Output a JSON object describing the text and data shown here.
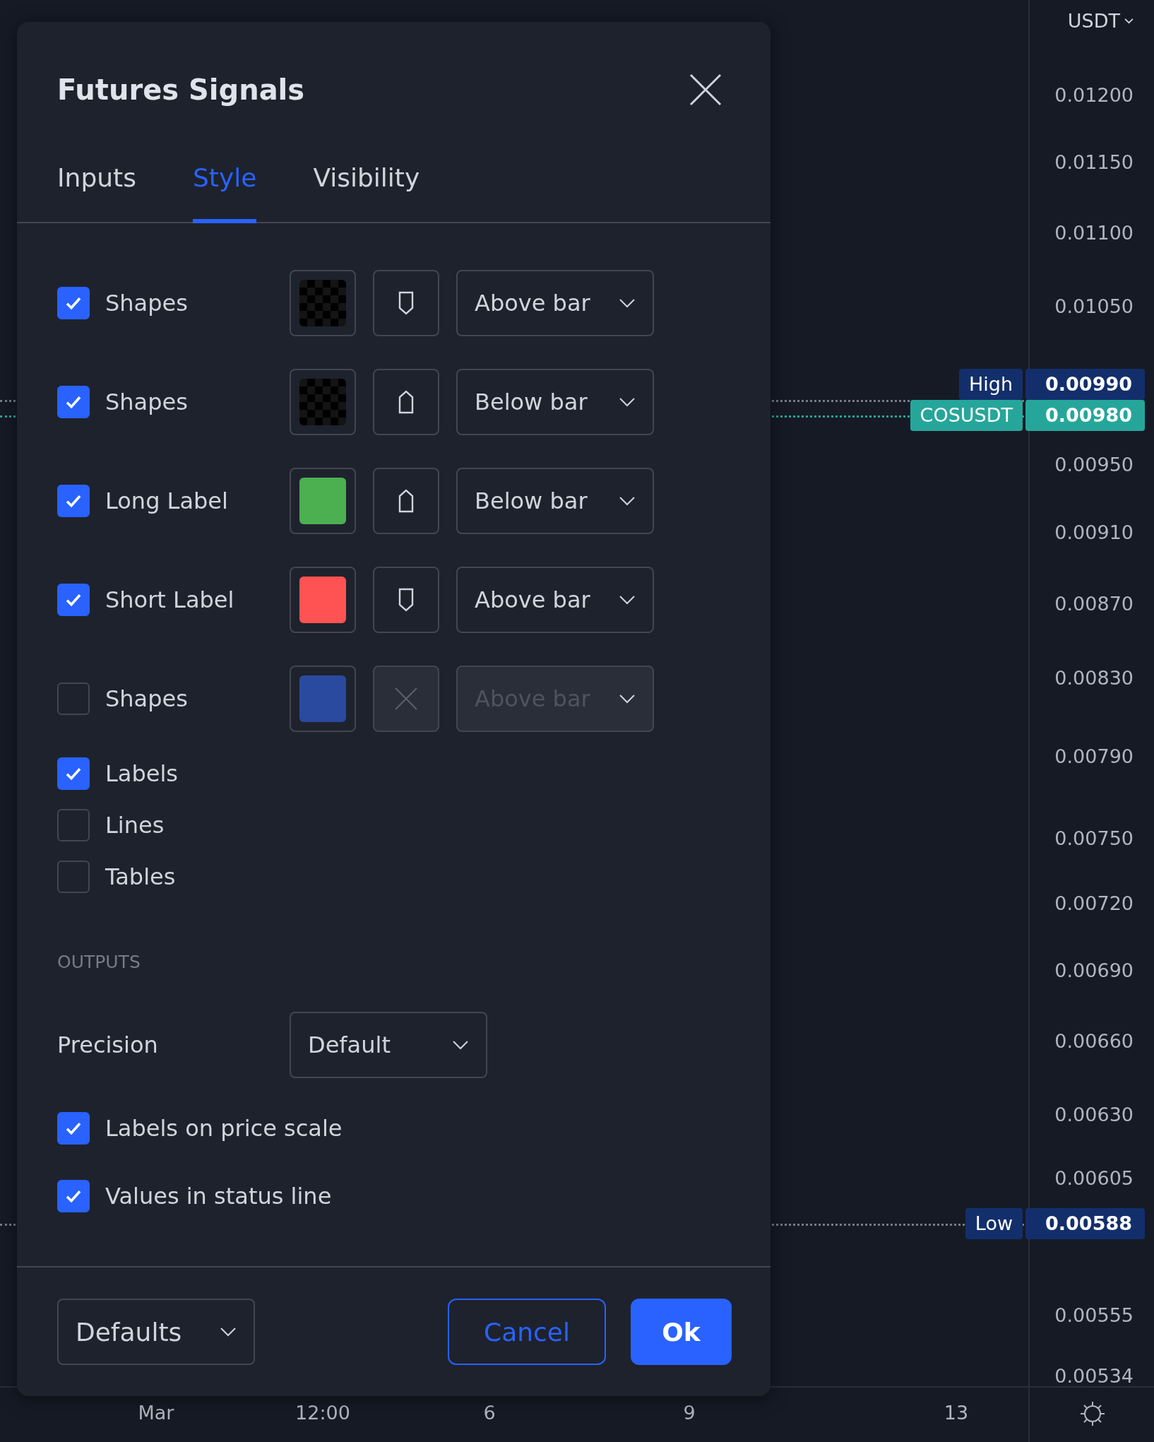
{
  "dialog": {
    "title": "Futures Signals",
    "tabs": [
      {
        "label": "Inputs",
        "selected": false
      },
      {
        "label": "Style",
        "selected": true
      },
      {
        "label": "Visibility",
        "selected": false
      }
    ],
    "plots": [
      {
        "label": "Shapes",
        "checked": true,
        "transparent": true,
        "kind": "down",
        "location": "Above bar",
        "disabled": false
      },
      {
        "label": "Shapes",
        "checked": true,
        "transparent": true,
        "kind": "up",
        "location": "Below bar",
        "disabled": false
      },
      {
        "label": "Long Label",
        "checked": true,
        "transparent": false,
        "color": "#4caf50",
        "kind": "up",
        "location": "Below bar",
        "disabled": false
      },
      {
        "label": "Short Label",
        "checked": true,
        "transparent": false,
        "color": "#ff5252",
        "kind": "down",
        "location": "Above bar",
        "disabled": false
      },
      {
        "label": "Shapes",
        "checked": false,
        "transparent": false,
        "color": "#2a4aa0",
        "kind": "none",
        "location": "Above bar",
        "disabled": true
      }
    ],
    "toggles": [
      {
        "label": "Labels",
        "checked": true
      },
      {
        "label": "Lines",
        "checked": false
      },
      {
        "label": "Tables",
        "checked": false
      }
    ],
    "outputs": {
      "heading": "OUTPUTS",
      "precision": {
        "label": "Precision",
        "value": "Default"
      },
      "options": [
        {
          "label": "Labels on price scale",
          "checked": true
        },
        {
          "label": "Values in status line",
          "checked": true
        }
      ]
    },
    "footer": {
      "preset": "Defaults",
      "cancel": "Cancel",
      "ok": "Ok"
    }
  },
  "price_axis": {
    "currency": "USDT",
    "ticks": [
      "0.01200",
      "0.01150",
      "0.01100",
      "0.01050",
      "0.00950",
      "0.00910",
      "0.00870",
      "0.00830",
      "0.00790",
      "0.00750",
      "0.00720",
      "0.00690",
      "0.00660",
      "0.00630",
      "0.00605",
      "0.00555",
      "0.00534"
    ],
    "tags": [
      {
        "kind": "high",
        "name": "High",
        "price": "0.00990",
        "color": "#132f6b"
      },
      {
        "kind": "last",
        "name": "COSUSDT",
        "price": "0.00980",
        "color": "#26a69a"
      },
      {
        "kind": "low",
        "name": "Low",
        "price": "0.00588",
        "color": "#132f6b"
      }
    ]
  },
  "time_axis": {
    "labels": [
      "Mar",
      "12:00",
      "6",
      "9",
      "13"
    ]
  }
}
